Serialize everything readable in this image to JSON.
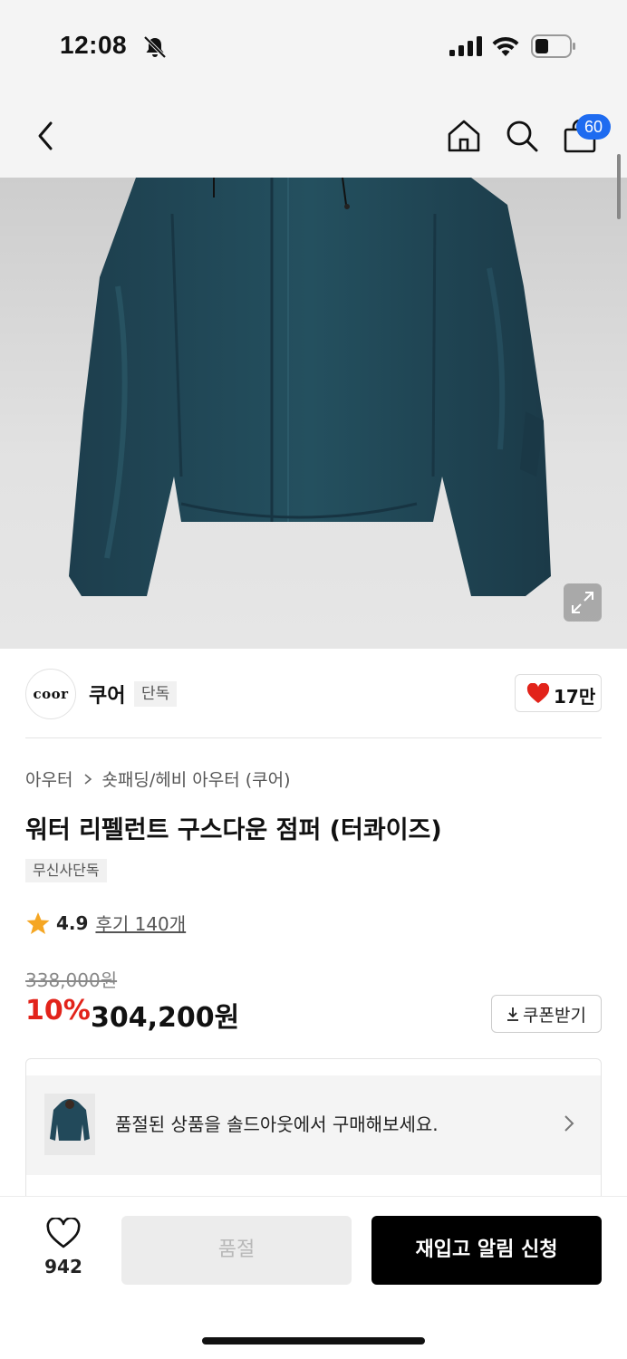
{
  "status_bar": {
    "time": "12:08"
  },
  "nav": {
    "cart_count": "60"
  },
  "brand": {
    "logo_text": "coor",
    "name": "쿠어",
    "tag": "단독",
    "like_count": "17만"
  },
  "breadcrumb": {
    "level1": "아우터",
    "level2": "숏패딩/헤비 아우터 (쿠어)"
  },
  "product": {
    "title": "워터 리펠런트 구스다운 점퍼 (터콰이즈)",
    "badge": "무신사단독",
    "rating": "4.9",
    "review_link": "후기 140개",
    "original_price": "338,000원",
    "discount_rate": "10%",
    "sale_price": "304,200원",
    "coupon_label": "쿠폰받기"
  },
  "soldout_banner": {
    "text": "품절된 상품을 솔드아웃에서 구매해보세요."
  },
  "bottom_bar": {
    "wish_count": "942",
    "soldout_label": "품절",
    "restock_label": "재입고 알림 신청"
  },
  "colors": {
    "accent_blue": "#1e6bf0",
    "discount_red": "#e2231a",
    "star": "#f5a623",
    "jacket": "#22495a"
  }
}
